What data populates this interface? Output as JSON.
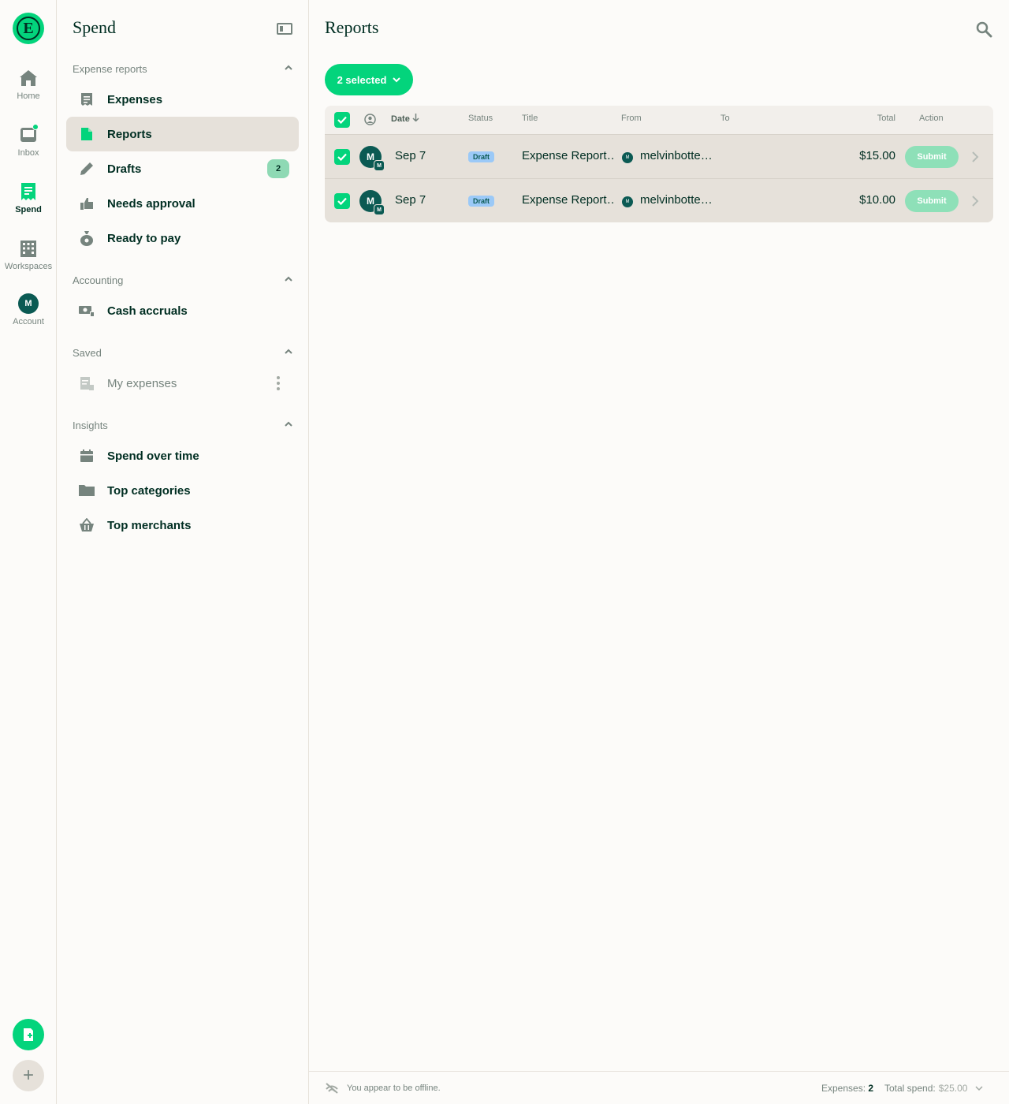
{
  "rail": {
    "logo_letter": "E",
    "items": [
      {
        "label": "Home",
        "icon": "home-icon"
      },
      {
        "label": "Inbox",
        "icon": "inbox-icon"
      },
      {
        "label": "Spend",
        "icon": "receipt-icon"
      },
      {
        "label": "Workspaces",
        "icon": "building-icon"
      },
      {
        "label": "Account",
        "icon": "avatar",
        "initial": "M"
      }
    ],
    "fab_plus": "+"
  },
  "sidebar": {
    "title": "Spend",
    "sections": [
      {
        "header": "Expense reports",
        "items": [
          {
            "label": "Expenses",
            "icon": "receipt-icon"
          },
          {
            "label": "Reports",
            "icon": "document-icon",
            "active": true
          },
          {
            "label": "Drafts",
            "icon": "pencil-icon",
            "badge": "2"
          },
          {
            "label": "Needs approval",
            "icon": "thumbs-up-icon"
          },
          {
            "label": "Ready to pay",
            "icon": "money-bag-icon"
          }
        ]
      },
      {
        "header": "Accounting",
        "items": [
          {
            "label": "Cash accruals",
            "icon": "cash-icon"
          }
        ]
      },
      {
        "header": "Saved",
        "items": [
          {
            "label": "My expenses",
            "icon": "saved-search-icon"
          }
        ]
      },
      {
        "header": "Insights",
        "items": [
          {
            "label": "Spend over time",
            "icon": "calendar-icon"
          },
          {
            "label": "Top categories",
            "icon": "folder-icon"
          },
          {
            "label": "Top merchants",
            "icon": "basket-icon"
          }
        ]
      }
    ]
  },
  "main": {
    "title": "Reports",
    "selection_label": "2 selected",
    "table": {
      "headers": {
        "date": "Date",
        "status": "Status",
        "title": "Title",
        "from": "From",
        "to": "To",
        "total": "Total",
        "action": "Action"
      },
      "rows": [
        {
          "avatar": "M",
          "avatar_sub": "M",
          "date": "Sep 7",
          "status": "Draft",
          "title": "Expense Report…",
          "from_avatar": "M",
          "from": "melvinbotte…",
          "to": "",
          "total": "$15.00",
          "action": "Submit"
        },
        {
          "avatar": "M",
          "avatar_sub": "M",
          "date": "Sep 7",
          "status": "Draft",
          "title": "Expense Report…",
          "from_avatar": "M",
          "from": "melvinbotte…",
          "to": "",
          "total": "$10.00",
          "action": "Submit"
        }
      ]
    },
    "footer": {
      "offline": "You appear to be offline.",
      "expenses_label": "Expenses:",
      "expenses_count": "2",
      "spend_label": "Total spend:",
      "spend_value": "$25.00"
    }
  },
  "colors": {
    "accent": "#03d47c",
    "text": "#002e22",
    "muted": "#76847e",
    "active_bg": "#e6e1da",
    "status_draft": "#9bc9f7"
  }
}
